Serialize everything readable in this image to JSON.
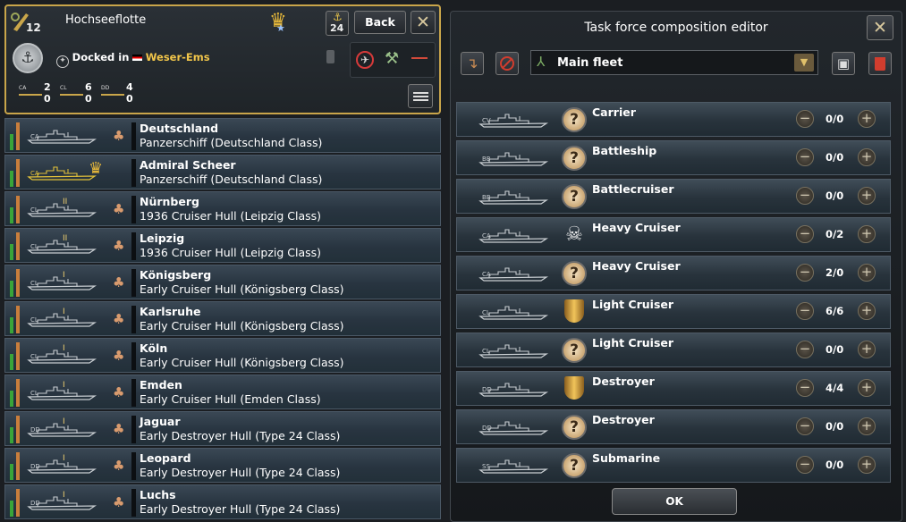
{
  "fleet": {
    "name": "Hochseeflotte",
    "admiral_skill": "12",
    "rank_num": "24",
    "back_label": "Back",
    "status": "Docked in",
    "location": "Weser-Ems",
    "composition": [
      {
        "type": "CA",
        "top": "2",
        "bottom": "0"
      },
      {
        "type": "CL",
        "top": "6",
        "bottom": "0"
      },
      {
        "type": "DD",
        "top": "4",
        "bottom": "0"
      }
    ]
  },
  "ships": [
    {
      "name": "Deutschland",
      "hull": "Panzerschiff (Deutschland Class)",
      "cls": "CA",
      "tier": "",
      "icon": "clover-icon",
      "sel": false
    },
    {
      "name": "Admiral Scheer",
      "hull": "Panzerschiff (Deutschland Class)",
      "cls": "CA",
      "tier": "",
      "icon": "crown-icon",
      "sel": true
    },
    {
      "name": "Nürnberg",
      "hull": "1936 Cruiser Hull (Leipzig Class)",
      "cls": "CL",
      "tier": "II",
      "icon": "clover-icon",
      "sel": false
    },
    {
      "name": "Leipzig",
      "hull": "1936 Cruiser Hull (Leipzig Class)",
      "cls": "CL",
      "tier": "II",
      "icon": "clover-icon",
      "sel": false
    },
    {
      "name": "Königsberg",
      "hull": "Early Cruiser Hull (Königsberg Class)",
      "cls": "CL",
      "tier": "I",
      "icon": "clover-icon",
      "sel": false
    },
    {
      "name": "Karlsruhe",
      "hull": "Early Cruiser Hull (Königsberg Class)",
      "cls": "CL",
      "tier": "I",
      "icon": "clover-icon",
      "sel": false
    },
    {
      "name": "Köln",
      "hull": "Early Cruiser Hull (Königsberg Class)",
      "cls": "CL",
      "tier": "I",
      "icon": "clover-icon",
      "sel": false
    },
    {
      "name": "Emden",
      "hull": "Early Cruiser Hull (Emden Class)",
      "cls": "CL",
      "tier": "I",
      "icon": "clover-icon",
      "sel": false
    },
    {
      "name": "Jaguar",
      "hull": "Early Destroyer Hull (Type 24 Class)",
      "cls": "DD",
      "tier": "I",
      "icon": "clover-icon",
      "sel": false
    },
    {
      "name": "Leopard",
      "hull": "Early Destroyer Hull (Type 24 Class)",
      "cls": "DD",
      "tier": "I",
      "icon": "clover-icon",
      "sel": false
    },
    {
      "name": "Luchs",
      "hull": "Early Destroyer Hull (Type 24 Class)",
      "cls": "DD",
      "tier": "I",
      "icon": "clover-icon",
      "sel": false
    }
  ],
  "editor": {
    "title": "Task force composition editor",
    "fleet_template": "Main fleet",
    "ok_label": "OK",
    "rows": [
      {
        "name": "Carrier",
        "cls": "CV",
        "icon": "question-icon",
        "count": "0/0"
      },
      {
        "name": "Battleship",
        "cls": "BB",
        "icon": "question-icon",
        "count": "0/0"
      },
      {
        "name": "Battlecruiser",
        "cls": "BB",
        "icon": "question-icon",
        "count": "0/0"
      },
      {
        "name": "Heavy Cruiser",
        "cls": "CA",
        "icon": "skull-icon",
        "count": "0/2"
      },
      {
        "name": "Heavy Cruiser",
        "cls": "CA",
        "icon": "question-icon",
        "count": "2/0"
      },
      {
        "name": "Light Cruiser",
        "cls": "CL",
        "icon": "shield-icon",
        "count": "6/6"
      },
      {
        "name": "Light Cruiser",
        "cls": "CL",
        "icon": "question-icon",
        "count": "0/0"
      },
      {
        "name": "Destroyer",
        "cls": "DD",
        "icon": "shield-icon",
        "count": "4/4"
      },
      {
        "name": "Destroyer",
        "cls": "DD",
        "icon": "question-icon",
        "count": "0/0"
      },
      {
        "name": "Submarine",
        "cls": "SS",
        "icon": "question-icon",
        "count": "0/0"
      }
    ]
  }
}
